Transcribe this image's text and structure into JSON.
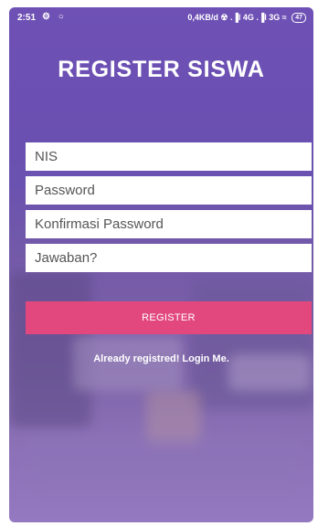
{
  "status_bar": {
    "time": "2:51",
    "left_icons": "⚙ ○",
    "right_text": "0,4KB/d ☢ .▐l 4G .▐l 3G ≈",
    "battery": "47"
  },
  "page": {
    "title": "REGISTER SISWA"
  },
  "form": {
    "nis_placeholder": "NIS",
    "password_placeholder": "Password",
    "confirm_placeholder": "Konfirmasi Password",
    "answer_placeholder": "Jawaban?",
    "register_label": "REGISTER",
    "login_link": "Already registred! Login Me."
  },
  "colors": {
    "background": "#6d51b3",
    "accent": "#e2487e",
    "field_background": "#ffffff"
  }
}
